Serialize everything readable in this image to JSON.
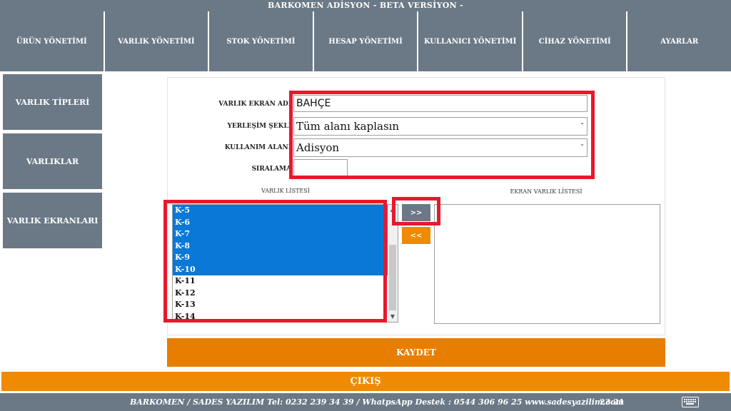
{
  "app": {
    "title": "BARKOMEN ADİSYON - BETA VERSİYON -"
  },
  "top_nav": [
    "ÜRÜN YÖNETİMİ",
    "VARLIK YÖNETİMİ",
    "STOK YÖNETİMİ",
    "HESAP YÖNETİMİ",
    "KULLANICI YÖNETİMİ",
    "CİHAZ YÖNETİMİ",
    "AYARLAR"
  ],
  "side_nav": [
    "VARLIK TİPLERİ",
    "VARLIKLAR",
    "VARLIK EKRANLARI"
  ],
  "form": {
    "name_label": "VARLIK EKRAN ADI",
    "name_value": "BAHÇE",
    "layout_label": "YERLEŞİM ŞEKLİ",
    "layout_value": "Tüm alanı kaplasın",
    "usage_label": "KULLANIM ALANI",
    "usage_value": "Adisyon",
    "order_label": "SIRALAMA",
    "order_value": ""
  },
  "lists": {
    "left_caption": "VARLIK LİSTESİ",
    "right_caption": "EKRAN VARLIK LİSTESİ",
    "items": [
      {
        "label": "K-5",
        "selected": true
      },
      {
        "label": "K-6",
        "selected": true
      },
      {
        "label": "K-7",
        "selected": true
      },
      {
        "label": "K-8",
        "selected": true
      },
      {
        "label": "K-9",
        "selected": true
      },
      {
        "label": "K-10",
        "selected": true
      },
      {
        "label": "K-11",
        "selected": false
      },
      {
        "label": "K-12",
        "selected": false
      },
      {
        "label": "K-13",
        "selected": false
      },
      {
        "label": "K-14",
        "selected": false
      }
    ],
    "right_items": []
  },
  "buttons": {
    "add": ">>",
    "remove": "<<",
    "save": "KAYDET",
    "exit": "ÇIKIŞ"
  },
  "footer": {
    "text": "BARKOMEN / SADES YAZILIM  Tel: 0232 239 34 39  / WhatpsApp Destek : 0544 306 96 25  www.sadesyazilim.com",
    "time": "23:21",
    "keyboard_icon": "keyboard-icon"
  },
  "colors": {
    "nav_bg": "#6b7886",
    "accent_orange": "#f08a00",
    "selection_blue": "#0a78d6",
    "highlight_red": "#e8182d"
  }
}
